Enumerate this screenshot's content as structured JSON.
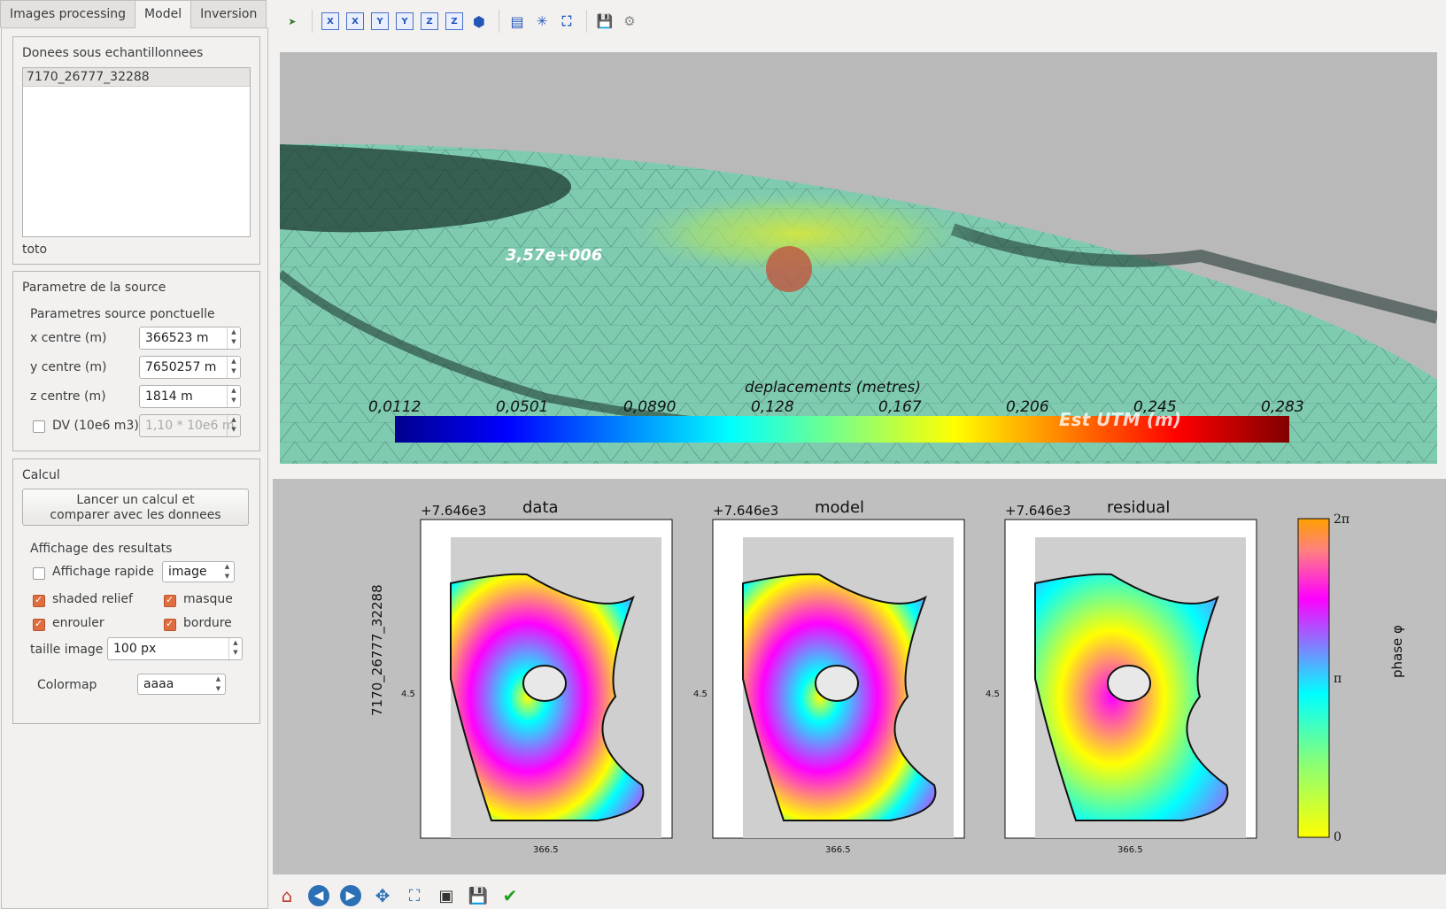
{
  "tabs": [
    {
      "label": "Images processing"
    },
    {
      "label": "Model"
    },
    {
      "label": "Inversion"
    }
  ],
  "data_group": {
    "title": "Donees sous echantillonnees",
    "items": [
      "7170_26777_32288"
    ],
    "footer": "toto"
  },
  "source_group": {
    "title": "Parametre de la source",
    "subtitle": "Parametres source ponctuelle",
    "x_label": "x centre (m)",
    "x_value": "366523 m",
    "y_label": "y centre (m)",
    "y_value": "7650257 m",
    "z_label": "z centre (m)",
    "z_value": "1814 m",
    "dv_label": "DV (10e6 m3)",
    "dv_value": "1,10 * 10e6 m"
  },
  "calc_group": {
    "title": "Calcul",
    "run_button_line1": "Lancer un calcul et",
    "run_button_line2": "comparer avec les donnees",
    "display_title": "Affichage des resultats",
    "fast_label": "Affichage rapide",
    "fast_select": "image",
    "shaded_label": "shaded relief",
    "mask_label": "masque",
    "wrap_label": "enrouler",
    "border_label": "bordure",
    "size_label": "taille image",
    "size_value": "100 px",
    "colormap_label": "Colormap",
    "colormap_value": "aaaa"
  },
  "toolbar_icons": [
    "pick-icon",
    "x-axis-icon",
    "x-axis-neg-icon",
    "y-axis-icon",
    "y-axis-neg-icon",
    "z-axis-icon",
    "z-axis-neg-icon",
    "cube-icon",
    "layers-icon",
    "axes-icon",
    "fit-icon",
    "save-icon",
    "settings-icon"
  ],
  "view3d": {
    "colorbar_title": "deplacements (metres)",
    "ticks": [
      "0,0112",
      "0,0501",
      "0,0890",
      "0,128",
      "0,167",
      "0,206",
      "0,245",
      "0,283"
    ],
    "overlay_label": "3,57e+006",
    "axis_partial": "Est UTM (m)"
  },
  "figure": {
    "panels": [
      {
        "title": "data",
        "offset": "+7.646e3",
        "xtick": "366.5",
        "ytick": "4.5"
      },
      {
        "title": "model",
        "offset": "+7.646e3",
        "xtick": "366.5",
        "ytick": "4.5"
      },
      {
        "title": "residual",
        "offset": "+7.646e3",
        "xtick": "366.5",
        "ytick": "4.5"
      }
    ],
    "ylabel": "7170_26777_32288",
    "cbar_label": "phase φ",
    "cbar_top": "2π",
    "cbar_mid": "π",
    "cbar_bottom": "0"
  },
  "colors": {
    "accent": "#e06d40",
    "mesh": "#7fcbb0"
  }
}
